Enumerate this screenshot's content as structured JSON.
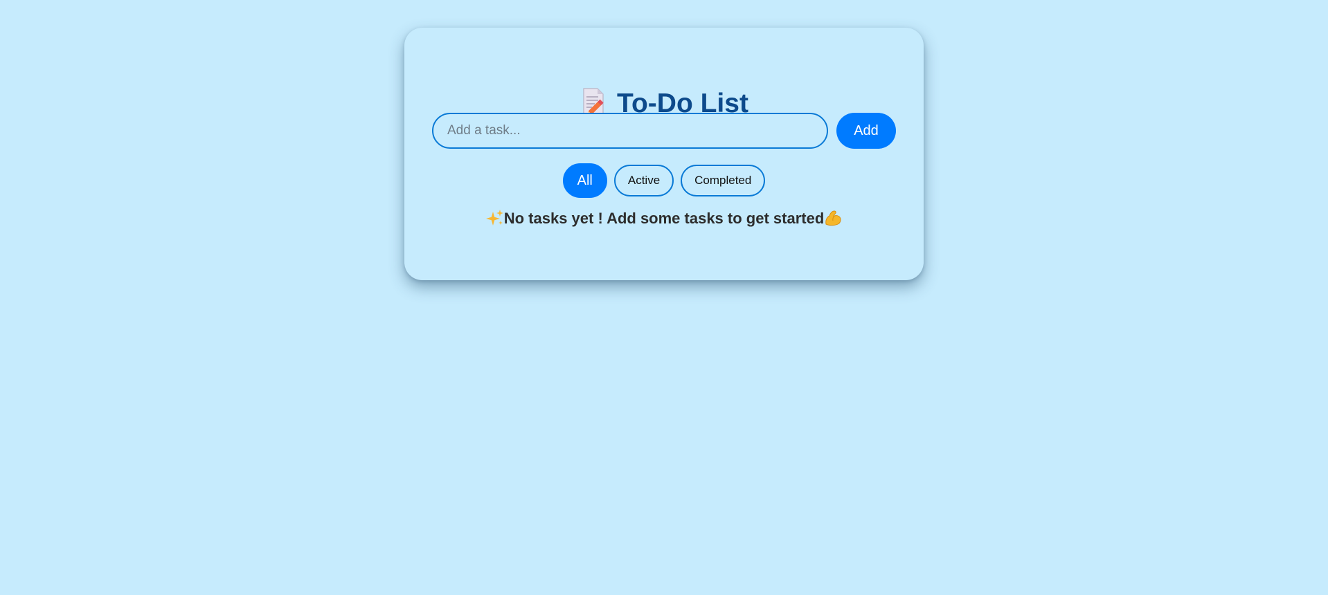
{
  "app": {
    "title": "To-Do List",
    "title_icon": "memo-icon"
  },
  "new_task": {
    "placeholder": "Add a task...",
    "value": "",
    "add_label": "Add"
  },
  "filters": {
    "items": [
      {
        "label": "All",
        "active": true
      },
      {
        "label": "Active",
        "active": false
      },
      {
        "label": "Completed",
        "active": false
      }
    ]
  },
  "empty_state": {
    "leading_icon": "sparkles-icon",
    "message": "No tasks yet ! Add some tasks to get started",
    "trailing_icon": "flexed-biceps-icon"
  },
  "colors": {
    "background": "#c6ebfd",
    "accent": "#007bff",
    "title": "#0d4a8b",
    "border": "#0a7ad6",
    "text": "#2d2d2d"
  }
}
